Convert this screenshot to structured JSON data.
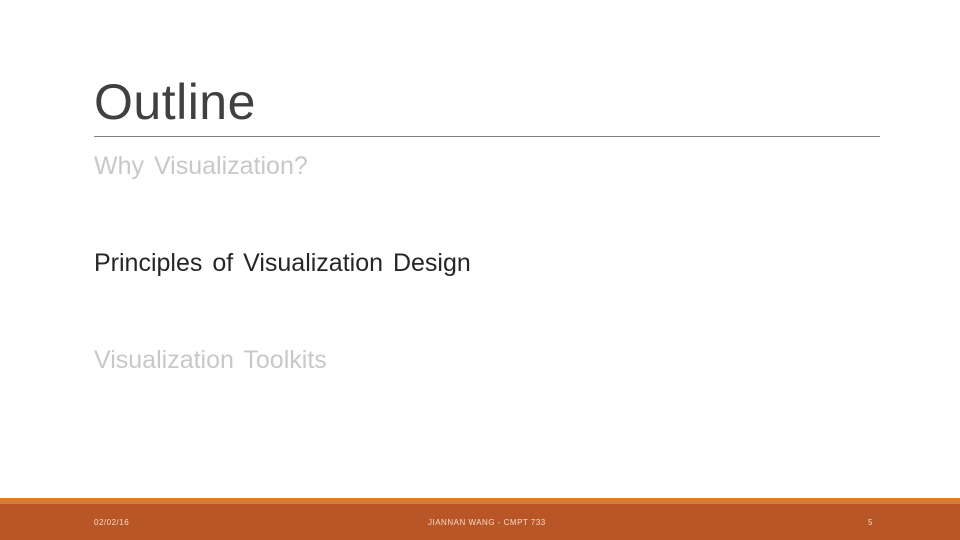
{
  "slide": {
    "title": "Outline",
    "items": [
      "Why  Visualization?",
      "Principles  of  Visualization  Design",
      "Visualization Toolkits"
    ],
    "footer": {
      "date": "02/02/16",
      "center": "JIANNAN WANG - CMPT 733",
      "page": "5"
    }
  },
  "colors": {
    "title_text": "#404040",
    "active_item_text": "#262626",
    "dimmed_item_text": "#c8c8c8",
    "footer_accent": "#e07b24",
    "footer_bar": "#b95628",
    "footer_text": "#f6d9c6"
  }
}
